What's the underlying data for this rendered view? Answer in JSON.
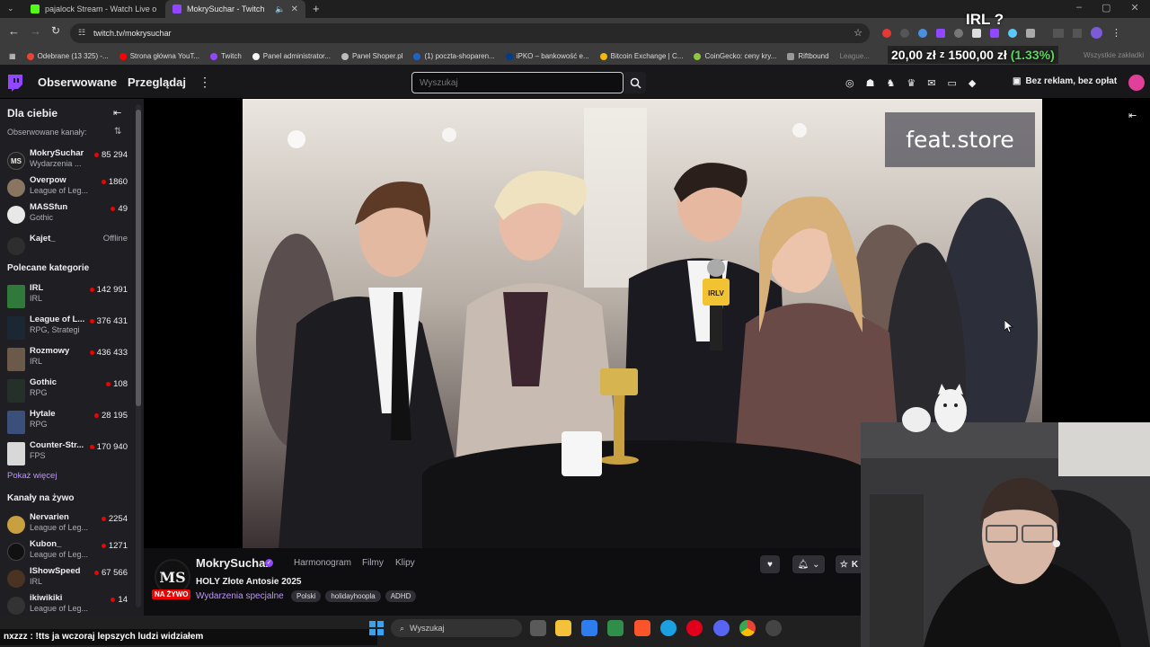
{
  "browser": {
    "tabs": [
      {
        "label": "pajalock Stream - Watch Live o",
        "active": false
      },
      {
        "label": "MokrySuchar - Twitch",
        "active": true
      }
    ],
    "url": "twitch.tv/mokrysuchar",
    "bookmarks": [
      "Odebrane (13 325) -...",
      "Strona główna YouT...",
      "Twitch",
      "Panel administrator...",
      "Panel Shoper.pl",
      "(1) poczta-shoparen...",
      "iPKO – bankowość e...",
      "Bitcoin Exchange | C...",
      "CoinGecko: ceny kry...",
      "Riftbound",
      "League...",
      "Wszystkie zakładki"
    ]
  },
  "overlay": {
    "irl_label": "IRL ?",
    "money_left": "20,00 zł",
    "money_mid": "z",
    "money_right": "1500,00 zł",
    "money_percent": "(1.33%)"
  },
  "twitch": {
    "nav": {
      "following": "Obserwowane",
      "browse": "Przeglądaj",
      "search_placeholder": "Wyszukaj",
      "turbo": "Bez reklam, bez opłat"
    },
    "sidebar": {
      "title": "Dla ciebie",
      "followed_label": "Obserwowane kanały:",
      "followed": [
        {
          "name": "MokrySuchar",
          "sub": "Wydarzenia ...",
          "viewers": "85 294"
        },
        {
          "name": "Overpow",
          "sub": "League of Leg...",
          "viewers": "1860"
        },
        {
          "name": "MASSfun",
          "sub": "Gothic",
          "viewers": "49"
        },
        {
          "name": "Kajet_",
          "sub": "",
          "viewers": "Offline"
        }
      ],
      "categories_label": "Polecane kategorie",
      "categories": [
        {
          "name": "IRL",
          "sub": "IRL",
          "viewers": "142 991"
        },
        {
          "name": "League of L...",
          "sub": "RPG, Strategi",
          "viewers": "376 431"
        },
        {
          "name": "Rozmowy",
          "sub": "IRL",
          "viewers": "436 433"
        },
        {
          "name": "Gothic",
          "sub": "RPG",
          "viewers": "108"
        },
        {
          "name": "Hytale",
          "sub": "RPG",
          "viewers": "28 195"
        },
        {
          "name": "Counter-Str...",
          "sub": "FPS",
          "viewers": "170 940"
        }
      ],
      "show_more": "Pokaż więcej",
      "live_label": "Kanały na żywo",
      "live": [
        {
          "name": "Nervarien",
          "sub": "League of Leg...",
          "viewers": "2254"
        },
        {
          "name": "Kubon_",
          "sub": "League of Leg...",
          "viewers": "1271"
        },
        {
          "name": "IShowSpeed",
          "sub": "IRL",
          "viewers": "67 566"
        },
        {
          "name": "ikiwikiki",
          "sub": "League of Leg...",
          "viewers": "14"
        }
      ]
    },
    "video": {
      "watermark": "feat.store",
      "mic_label": "IRLV"
    },
    "channel": {
      "avatar_text": "MS",
      "name": "MokrySuchar",
      "tabs": [
        "Harmonogram",
        "Filmy",
        "Klipy"
      ],
      "title": "HOLY Złote Antosie 2025",
      "live_badge": "NA ŻYWO",
      "category": "Wydarzenia specjalne",
      "tags": [
        "Polski",
        "holidayhoopla",
        "ADHD"
      ],
      "follow_partial": "K"
    }
  },
  "chat_message": "nxzzz : !tts ja wczoraj lepszych ludzi widziałem",
  "taskbar": {
    "search": "Wyszukaj"
  }
}
